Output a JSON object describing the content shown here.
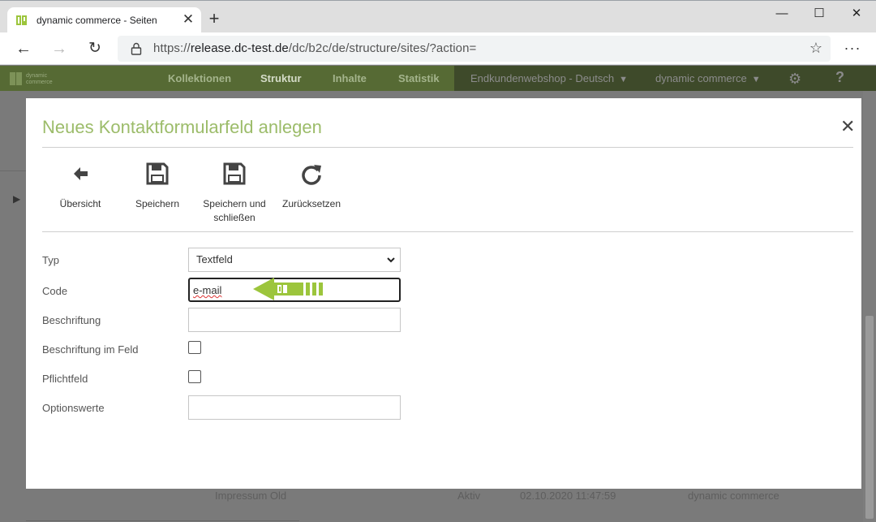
{
  "browser": {
    "tab_title": "dynamic commerce - Seiten",
    "tab_close": "✕",
    "new_tab": "+",
    "url_prefix": "https://",
    "url_host": "release.dc-test.de",
    "url_path": "/dc/b2c/de/structure/sites/?action=",
    "window_controls": {
      "minimize": "—",
      "maximize": "☐",
      "close": "✕"
    }
  },
  "app_header": {
    "nav": [
      "Kollektionen",
      "Struktur",
      "Inhalte",
      "Statistik"
    ],
    "active_nav": "Struktur",
    "shop_select": "Endkundenwebshop - Deutsch",
    "user_select": "dynamic commerce",
    "help": "?"
  },
  "background_row": {
    "name": "Impressum Old",
    "status": "Aktiv",
    "date": "02.10.2020 11:47:59",
    "owner": "dynamic commerce"
  },
  "modal": {
    "title": "Neues Kontaktformularfeld anlegen",
    "close": "✕",
    "actions": [
      {
        "label": "Übersicht",
        "icon": "arrow-left-icon"
      },
      {
        "label": "Speichern",
        "icon": "save-icon"
      },
      {
        "label": "Speichern und schließen",
        "icon": "save-icon"
      },
      {
        "label": "Zurücksetzen",
        "icon": "reset-icon"
      }
    ],
    "form": {
      "type_label": "Typ",
      "type_value": "Textfeld",
      "code_label": "Code",
      "code_value": "e-mail",
      "caption_label": "Beschriftung",
      "caption_value": "",
      "caption_in_field_label": "Beschriftung im Feld",
      "caption_in_field_checked": false,
      "required_label": "Pflichtfeld",
      "required_checked": false,
      "option_values_label": "Optionswerte",
      "option_values_value": ""
    }
  },
  "colors": {
    "brand_green": "#9cbc6a",
    "header_green": "#566a34",
    "pointer_green": "#9cc53c"
  }
}
